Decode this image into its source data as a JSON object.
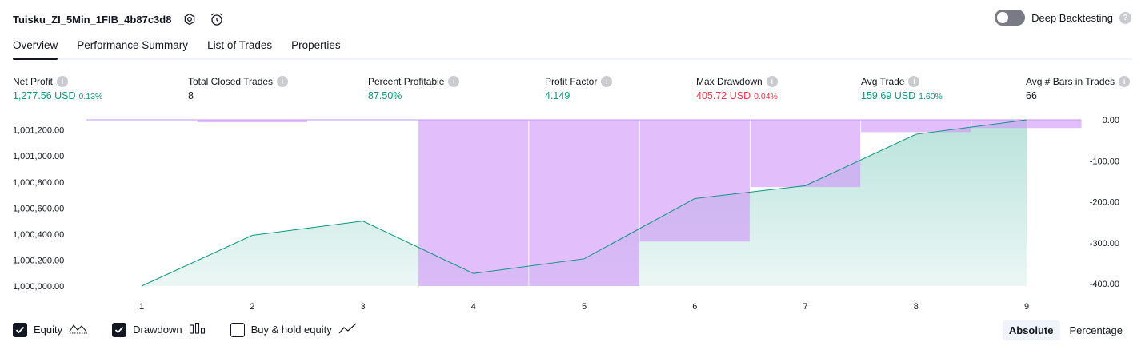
{
  "header": {
    "strategy_name": "Tuisku_ZI_5Min_1FIB_4b87c3d8",
    "icons": [
      "settings-icon",
      "alarm-add-icon"
    ]
  },
  "deep_backtesting": {
    "label": "Deep Backtesting",
    "enabled": false,
    "help": "?"
  },
  "tabs": [
    {
      "label": "Overview",
      "active": true
    },
    {
      "label": "Performance Summary",
      "active": false
    },
    {
      "label": "List of Trades",
      "active": false
    },
    {
      "label": "Properties",
      "active": false
    }
  ],
  "stats": {
    "info_glyph": "i",
    "net_profit": {
      "label": "Net Profit",
      "value": "1,277.56 USD",
      "pct": "0.13%"
    },
    "total_closed_trades": {
      "label": "Total Closed Trades",
      "value": "8"
    },
    "percent_profitable": {
      "label": "Percent Profitable",
      "value": "87.50%"
    },
    "profit_factor": {
      "label": "Profit Factor",
      "value": "4.149"
    },
    "max_drawdown": {
      "label": "Max Drawdown",
      "value": "405.72 USD",
      "pct": "0.04%"
    },
    "avg_trade": {
      "label": "Avg Trade",
      "value": "159.69 USD",
      "pct": "1.60%"
    },
    "avg_bars": {
      "label": "Avg # Bars in Trades",
      "value": "66"
    }
  },
  "chart_data": {
    "type": "line",
    "x": [
      1,
      2,
      3,
      4,
      5,
      6,
      7,
      8,
      9
    ],
    "x_tick_labels": [
      "1",
      "2",
      "3",
      "4",
      "5",
      "6",
      "7",
      "8",
      "9"
    ],
    "series": [
      {
        "name": "Equity",
        "axis": "left",
        "values": [
          1000000,
          1000390,
          1000500,
          1000097,
          1000210,
          1000673,
          1000772,
          1001167,
          1001278
        ]
      },
      {
        "name": "Drawdown",
        "axis": "right",
        "type": "bar",
        "values": [
          0,
          -6,
          0,
          -405.72,
          -405.72,
          -297,
          -164,
          -30,
          -20
        ]
      }
    ],
    "left_axis": {
      "ylim": [
        1000000,
        1001278
      ],
      "ticks": [
        "1,001,200.00",
        "1,001,000.00",
        "1,000,800.00",
        "1,000,600.00",
        "1,000,400.00",
        "1,000,200.00",
        "1,000,000.00"
      ],
      "tick_values": [
        1001200,
        1001000,
        1000800,
        1000600,
        1000400,
        1000200,
        1000000
      ]
    },
    "right_axis": {
      "ylim": [
        -405.72,
        0
      ],
      "ticks": [
        "0.00",
        "-100.00",
        "-200.00",
        "-300.00",
        "-400.00"
      ],
      "tick_values": [
        0,
        -100,
        -200,
        -300,
        -400
      ]
    },
    "colors": {
      "equity_line": "#089981",
      "equity_fill": "#089981",
      "drawdown_fill": "#ce93f8"
    },
    "grid": false
  },
  "legend": {
    "items": [
      {
        "label": "Equity",
        "checked": true,
        "icon": "equity-line-icon"
      },
      {
        "label": "Drawdown",
        "checked": true,
        "icon": "drawdown-bars-icon"
      },
      {
        "label": "Buy & hold equity",
        "checked": false,
        "icon": "buy-hold-line-icon"
      }
    ]
  },
  "scale_toggle": {
    "options": [
      "Absolute",
      "Percentage"
    ],
    "active": "Absolute"
  }
}
